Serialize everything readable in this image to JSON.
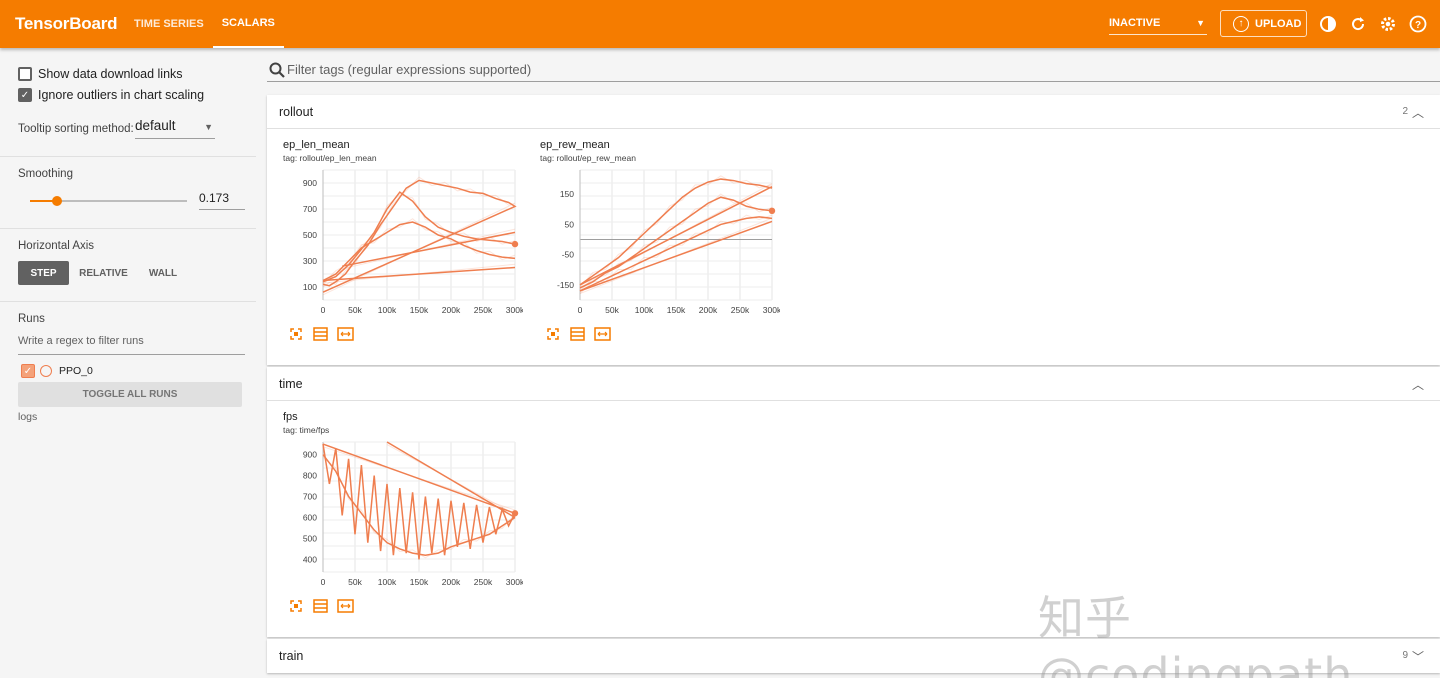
{
  "header": {
    "brand": "TensorBoard",
    "tabs": [
      {
        "label": "TIME SERIES"
      },
      {
        "label": "SCALARS"
      }
    ],
    "reload_select": "INACTIVE",
    "upload_label": "UPLOAD",
    "icons": [
      "contrast-icon",
      "refresh-icon",
      "settings-icon",
      "help-icon"
    ]
  },
  "sidebar": {
    "show_download": "Show data download links",
    "ignore_outliers": "Ignore outliers in chart scaling",
    "tooltip_label": "Tooltip sorting method:",
    "tooltip_value": "default",
    "smoothing_label": "Smoothing",
    "smoothing_value": "0.173",
    "smoothing_fraction": 0.173,
    "axis_label": "Horizontal Axis",
    "axis_options": [
      "STEP",
      "RELATIVE",
      "WALL"
    ],
    "runs_label": "Runs",
    "runs_filter_placeholder": "Write a regex to filter runs",
    "run_name": "PPO_0",
    "run_color": "#ef7e4f",
    "toggle_all": "TOGGLE ALL RUNS",
    "logdir": "logs"
  },
  "search": {
    "placeholder": "Filter tags (regular expressions supported)"
  },
  "groups": [
    {
      "name": "rollout",
      "count": "2"
    },
    {
      "name": "time",
      "count": ""
    },
    {
      "name": "train",
      "count": "9"
    }
  ],
  "cards": [
    {
      "title": "ep_len_mean",
      "tag": "tag: rollout/ep_len_mean"
    },
    {
      "title": "ep_rew_mean",
      "tag": "tag: rollout/ep_rew_mean"
    },
    {
      "title": "fps",
      "tag": "tag: time/fps"
    }
  ],
  "chart_data": [
    {
      "type": "line",
      "title": "ep_len_mean",
      "xlabel": "",
      "ylabel": "",
      "x_ticks": [
        "0",
        "50k",
        "100k",
        "150k",
        "200k",
        "250k",
        "300k"
      ],
      "y_ticks": [
        "100",
        "300",
        "500",
        "700",
        "900"
      ],
      "xlim": [
        0,
        300000
      ],
      "ylim": [
        0,
        1000
      ],
      "series": [
        {
          "x": [
            0,
            10000,
            20000,
            35000,
            50000,
            70000,
            90000,
            110000,
            130000,
            150000,
            170000,
            190000,
            210000,
            230000,
            250000,
            270000,
            290000,
            300000,
            0,
            300000
          ],
          "y": [
            120,
            110,
            140,
            200,
            300,
            420,
            580,
            720,
            860,
            920,
            900,
            880,
            860,
            830,
            820,
            780,
            750,
            720,
            60,
            720
          ]
        },
        {
          "x": [
            0,
            20000,
            40000,
            60000,
            80000,
            100000,
            120000,
            140000,
            160000,
            180000,
            200000,
            220000,
            240000,
            260000,
            280000,
            300000
          ],
          "y": [
            140,
            180,
            270,
            390,
            520,
            700,
            830,
            760,
            640,
            560,
            520,
            490,
            470,
            460,
            450,
            430
          ]
        },
        {
          "x": [
            0,
            20000,
            40000,
            60000,
            80000,
            100000,
            120000,
            140000,
            160000,
            180000,
            200000,
            220000,
            240000,
            260000,
            280000,
            300000
          ],
          "y": [
            150,
            200,
            300,
            400,
            460,
            520,
            580,
            600,
            560,
            500,
            470,
            420,
            380,
            350,
            330,
            320
          ]
        },
        {
          "x": [
            0,
            300000
          ],
          "y": [
            150,
            250
          ]
        },
        {
          "x": [
            30000,
            300000
          ],
          "y": [
            260,
            520
          ]
        }
      ],
      "last_point": {
        "x": 300000,
        "y": 430
      }
    },
    {
      "type": "line",
      "title": "ep_rew_mean",
      "xlabel": "",
      "ylabel": "",
      "x_ticks": [
        "0",
        "50k",
        "100k",
        "150k",
        "200k",
        "250k",
        "300k"
      ],
      "y_ticks": [
        "150",
        "50",
        "-50",
        "-150"
      ],
      "xlim": [
        0,
        300000
      ],
      "ylim": [
        -200,
        230
      ],
      "series": [
        {
          "x": [
            0,
            20000,
            40000,
            60000,
            80000,
            100000,
            120000,
            140000,
            160000,
            180000,
            200000,
            220000,
            240000,
            260000,
            280000,
            300000
          ],
          "y": [
            -150,
            -120,
            -90,
            -60,
            -20,
            20,
            60,
            100,
            140,
            170,
            190,
            200,
            195,
            185,
            180,
            170
          ]
        },
        {
          "x": [
            0,
            20000,
            40000,
            60000,
            80000,
            100000,
            120000,
            140000,
            160000,
            180000,
            200000,
            220000,
            240000,
            260000,
            280000,
            300000
          ],
          "y": [
            -160,
            -140,
            -110,
            -90,
            -60,
            -30,
            0,
            30,
            60,
            90,
            120,
            140,
            130,
            110,
            100,
            95
          ]
        },
        {
          "x": [
            0,
            20000,
            40000,
            60000,
            80000,
            100000,
            120000,
            140000,
            160000,
            180000,
            200000,
            220000,
            240000,
            260000,
            280000,
            300000
          ],
          "y": [
            -170,
            -150,
            -130,
            -110,
            -90,
            -70,
            -50,
            -30,
            -10,
            10,
            30,
            50,
            60,
            70,
            75,
            70
          ]
        },
        {
          "x": [
            0,
            300000
          ],
          "y": [
            -150,
            175
          ]
        },
        {
          "x": [
            0,
            300000
          ],
          "y": [
            -170,
            60
          ]
        }
      ],
      "last_point": {
        "x": 300000,
        "y": 95
      }
    },
    {
      "type": "line",
      "title": "fps",
      "xlabel": "",
      "ylabel": "",
      "x_ticks": [
        "0",
        "50k",
        "100k",
        "150k",
        "200k",
        "250k",
        "300k"
      ],
      "y_ticks": [
        "400",
        "500",
        "600",
        "700",
        "800",
        "900"
      ],
      "xlim": [
        0,
        300000
      ],
      "ylim": [
        340,
        960
      ],
      "series": [
        {
          "x": [
            0,
            10000,
            20000,
            30000,
            40000,
            50000,
            60000,
            70000,
            80000,
            90000,
            100000,
            110000,
            120000,
            130000,
            140000,
            150000,
            160000,
            170000,
            180000,
            190000,
            200000,
            210000,
            220000,
            230000,
            240000,
            250000,
            260000,
            270000,
            280000,
            290000,
            300000
          ],
          "y": [
            950,
            760,
            930,
            610,
            880,
            520,
            850,
            480,
            800,
            440,
            760,
            420,
            740,
            430,
            720,
            400,
            700,
            430,
            690,
            420,
            680,
            460,
            670,
            450,
            660,
            480,
            650,
            520,
            640,
            560,
            620
          ]
        },
        {
          "x": [
            0,
            20000,
            40000,
            60000,
            80000,
            100000,
            120000,
            140000,
            160000,
            180000,
            200000,
            220000,
            240000,
            260000,
            280000,
            300000
          ],
          "y": [
            900,
            820,
            700,
            620,
            540,
            480,
            450,
            430,
            420,
            430,
            460,
            480,
            500,
            520,
            560,
            600
          ]
        },
        {
          "x": [
            0,
            300000
          ],
          "y": [
            950,
            620
          ]
        },
        {
          "x": [
            100000,
            300000
          ],
          "y": [
            960,
            600
          ]
        }
      ],
      "last_point": {
        "x": 300000,
        "y": 620
      }
    }
  ],
  "watermark": "知乎 @codingpath"
}
